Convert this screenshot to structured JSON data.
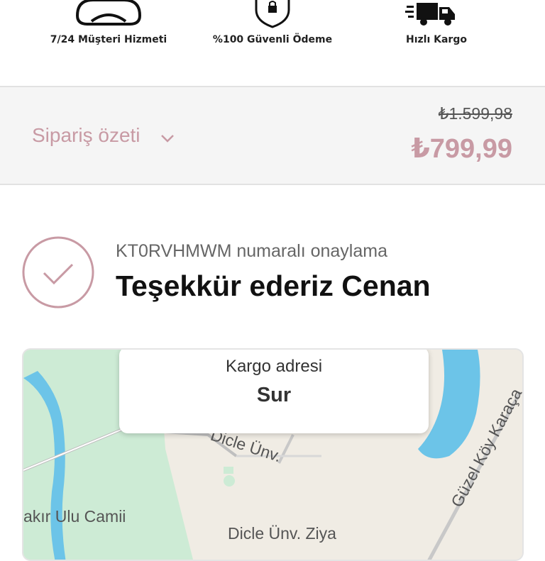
{
  "features": [
    {
      "icon": "headset-icon",
      "label": "7/24 Müşteri Hizmeti"
    },
    {
      "icon": "secure-lock-icon",
      "label": "%100 Güvenli Ödeme"
    },
    {
      "icon": "fast-truck-icon",
      "label": "Hızlı Kargo"
    }
  ],
  "order_summary": {
    "toggle_label": "Sipariş özeti",
    "old_price": "₺1.599,98",
    "price": "₺799,99"
  },
  "confirmation": {
    "number_text": "KT0RVHMWM numaralı onaylama",
    "thanks_text": "Teşekkür ederiz Cenan"
  },
  "map": {
    "address_title": "Kargo adresi",
    "address_value": "Sur",
    "labels": {
      "dicle_unv": "Dicle Ünv.",
      "guzel_koy": "Güzel Köy Karaça",
      "ulu_camii": "akır Ulu Camii",
      "dicle_ziya": "Dicle Ünv. Ziya"
    }
  },
  "colors": {
    "accent": "#c89aa4",
    "water": "#6cc4e8",
    "green": "#cdebd5",
    "land": "#f0ece4"
  }
}
